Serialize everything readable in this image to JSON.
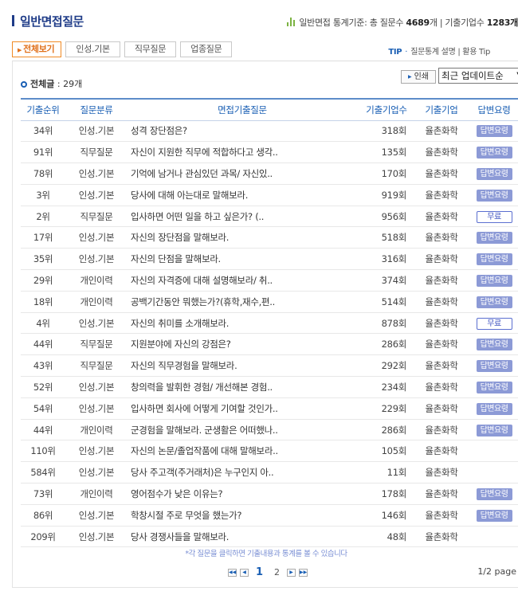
{
  "header": {
    "title": "일반면접질문",
    "stats_prefix": "일반면접 통계기준: 총 질문수",
    "total_questions": "4689",
    "questions_unit": "개 | 기출기업수",
    "companies": "1283개"
  },
  "tabs": [
    {
      "label": "전체보기",
      "active": true
    },
    {
      "label": "인성.기본"
    },
    {
      "label": "직무질문"
    },
    {
      "label": "업종질문"
    }
  ],
  "tip": {
    "label": "TIP",
    "text": "질문통계 설명 | 활용 Tip"
  },
  "list": {
    "count_label": "전체글",
    "count_value": ": 29개",
    "print_label": "인쇄",
    "sort_selected": "최근 업데이트순"
  },
  "table": {
    "columns": [
      "기출순위",
      "질문분류",
      "면접기출질문",
      "기출기업수",
      "기출기업",
      "답변요령"
    ],
    "rows": [
      {
        "rank": "34위",
        "category": "인성.기본",
        "question": "성격 장단점은?",
        "count": "318회",
        "company": "율촌화학",
        "answer": "답변요령"
      },
      {
        "rank": "91위",
        "category": "직무질문",
        "question": "자신이 지원한 직무에 적합하다고 생각..",
        "count": "135회",
        "company": "율촌화학",
        "answer": "답변요령"
      },
      {
        "rank": "78위",
        "category": "인성.기본",
        "question": "기억에 남거나 관심있던 과목/ 자신있..",
        "count": "170회",
        "company": "율촌화학",
        "answer": "답변요령"
      },
      {
        "rank": "3위",
        "category": "인성.기본",
        "question": "당사에 대해 아는대로 말해보라.",
        "count": "919회",
        "company": "율촌화학",
        "answer": "답변요령"
      },
      {
        "rank": "2위",
        "category": "직무질문",
        "question": "입사하면 어떤 일을 하고 싶은가? (..",
        "count": "956회",
        "company": "율촌화학",
        "answer": "무료"
      },
      {
        "rank": "17위",
        "category": "인성.기본",
        "question": "자신의 장단점을 말해보라.",
        "count": "518회",
        "company": "율촌화학",
        "answer": "답변요령"
      },
      {
        "rank": "35위",
        "category": "인성.기본",
        "question": "자신의 단점을 말해보라.",
        "count": "316회",
        "company": "율촌화학",
        "answer": "답변요령"
      },
      {
        "rank": "29위",
        "category": "개인이력",
        "question": "자신의 자격증에 대해 설명해보라/ 취..",
        "count": "374회",
        "company": "율촌화학",
        "answer": "답변요령"
      },
      {
        "rank": "18위",
        "category": "개인이력",
        "question": "공백기간동안 뭐했는가?(휴학,재수,편..",
        "count": "514회",
        "company": "율촌화학",
        "answer": "답변요령"
      },
      {
        "rank": "4위",
        "category": "인성.기본",
        "question": "자신의 취미를 소개해보라.",
        "count": "878회",
        "company": "율촌화학",
        "answer": "무료"
      },
      {
        "rank": "44위",
        "category": "직무질문",
        "question": "지원분야에 자신의 강점은?",
        "count": "286회",
        "company": "율촌화학",
        "answer": "답변요령"
      },
      {
        "rank": "43위",
        "category": "직무질문",
        "question": "자신의 직무경험을 말해보라.",
        "count": "292회",
        "company": "율촌화학",
        "answer": "답변요령"
      },
      {
        "rank": "52위",
        "category": "인성.기본",
        "question": "창의력을 발휘한 경험/ 개선해본 경험..",
        "count": "234회",
        "company": "율촌화학",
        "answer": "답변요령"
      },
      {
        "rank": "54위",
        "category": "인성.기본",
        "question": "입사하면 회사에 어떻게 기여할 것인가..",
        "count": "229회",
        "company": "율촌화학",
        "answer": "답변요령"
      },
      {
        "rank": "44위",
        "category": "개인이력",
        "question": "군경험을 말해보라. 군생활은 어떠했나..",
        "count": "286회",
        "company": "율촌화학",
        "answer": "답변요령"
      },
      {
        "rank": "110위",
        "category": "인성.기본",
        "question": "자신의 논문/졸업작품에 대해 말해보라..",
        "count": "105회",
        "company": "율촌화학",
        "answer": ""
      },
      {
        "rank": "584위",
        "category": "인성.기본",
        "question": "당사 주고객(주거래처)은 누구인지 아..",
        "count": "11회",
        "company": "율촌화학",
        "answer": ""
      },
      {
        "rank": "73위",
        "category": "개인이력",
        "question": "영어점수가 낮은 이유는?",
        "count": "178회",
        "company": "율촌화학",
        "answer": "답변요령"
      },
      {
        "rank": "86위",
        "category": "인성.기본",
        "question": "학창시절 주로 무엇을 했는가?",
        "count": "146회",
        "company": "율촌화학",
        "answer": "답변요령"
      },
      {
        "rank": "209위",
        "category": "인성.기본",
        "question": "당사 경쟁사들을 말해보라.",
        "count": "48회",
        "company": "율촌화학",
        "answer": ""
      }
    ]
  },
  "footer": {
    "note": "*각 질문을 클릭하면 기출내용과 통계를 볼 수 있습니다",
    "pages": [
      "1",
      "2"
    ],
    "current_page": "1",
    "page_info": "1/2 page"
  },
  "colors": {
    "accent": "#1a5fb4",
    "active_tab": "#f08a24",
    "badge": "#8c9ad6"
  }
}
